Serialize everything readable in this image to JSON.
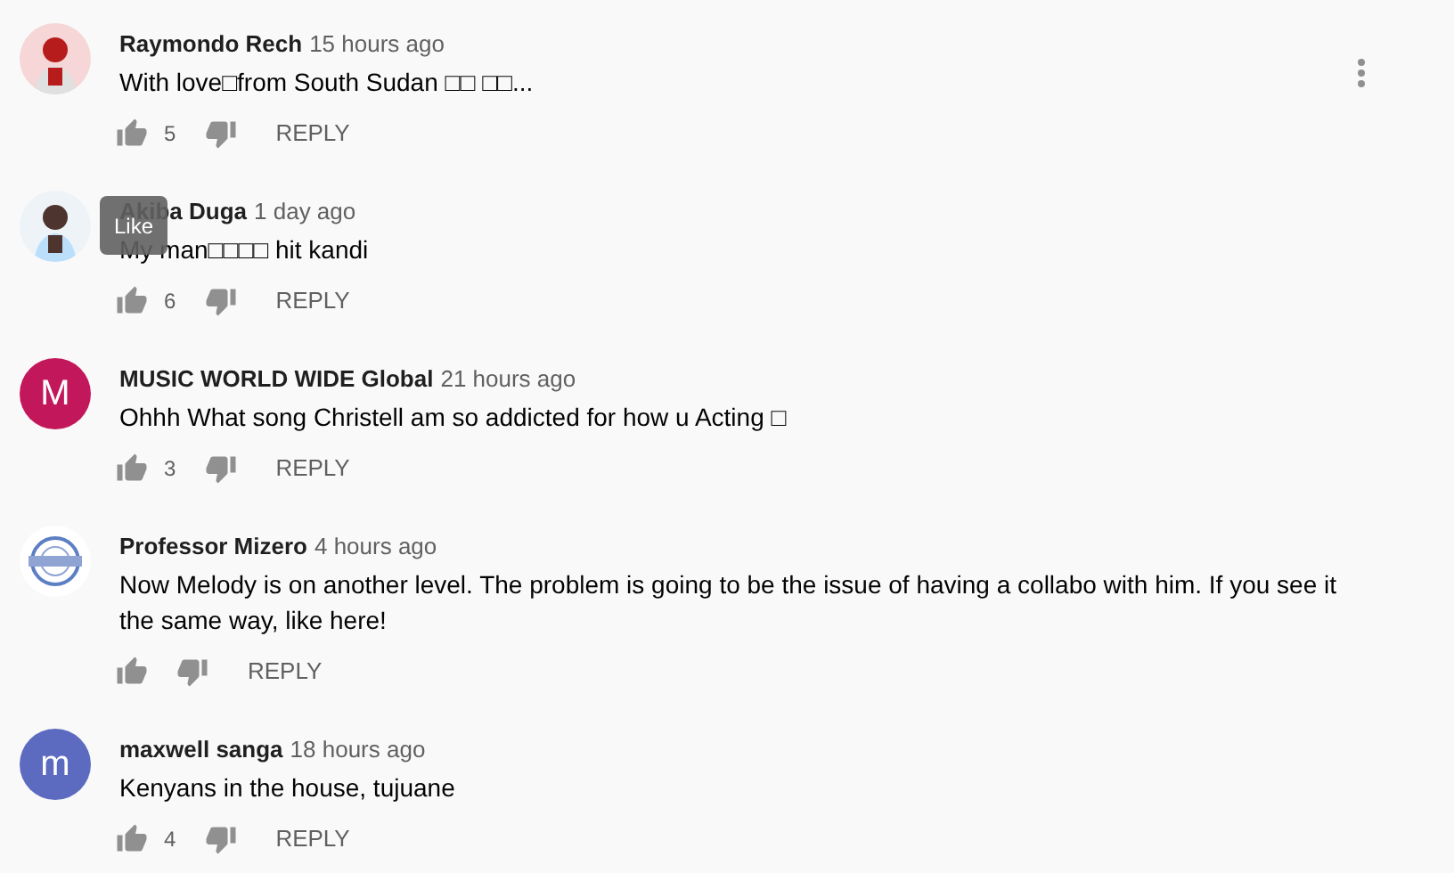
{
  "comments": [
    {
      "author": "Raymondo Rech",
      "time": "15 hours ago",
      "text": "With love□from South Sudan □□ □□...",
      "likes": "5",
      "reply_label": "REPLY",
      "menu_visible": true
    },
    {
      "author": "Akiba Duga",
      "time": "1 day ago",
      "text": "My man□□□□ hit kandi",
      "likes": "6",
      "reply_label": "REPLY",
      "menu_visible": false
    },
    {
      "author": "MUSIC WORLD WIDE Global",
      "time": "21 hours ago",
      "text": "Ohhh What song Christell am so addicted for how u Acting □",
      "avatar": {
        "kind": "letter",
        "letter": "M",
        "color": "#c2185b"
      },
      "likes": "3",
      "reply_label": "REPLY",
      "menu_visible": false
    },
    {
      "author": "Professor Mizero",
      "time": "4 hours ago",
      "text": "Now Melody is on another level. The problem is going to be the issue of having a collabo with him. If you see it the same way, like here!",
      "reply_label": "REPLY",
      "menu_visible": false
    },
    {
      "author": "maxwell sanga",
      "time": "18 hours ago",
      "text": "Kenyans in the house, tujuane",
      "avatar": {
        "kind": "letter",
        "letter": "m",
        "color": "#5c6bc0"
      },
      "likes": "4",
      "reply_label": "REPLY",
      "menu_visible": false
    }
  ],
  "tooltip": {
    "text": "Like"
  }
}
